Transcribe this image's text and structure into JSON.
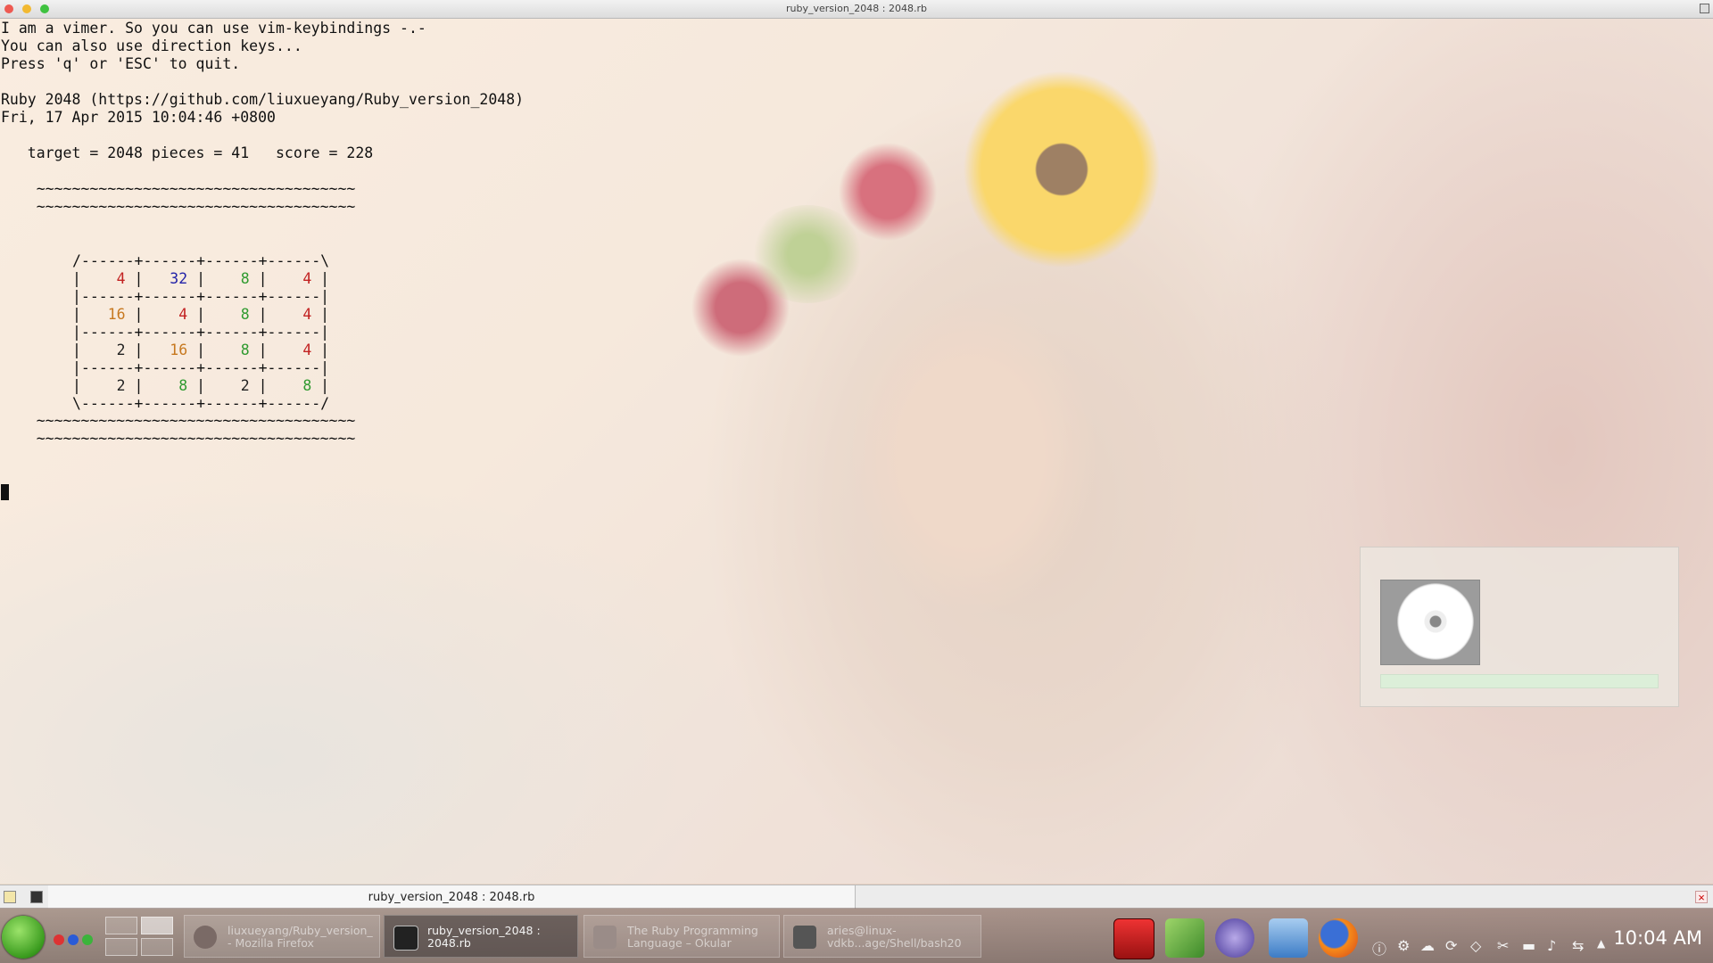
{
  "window": {
    "title": "ruby_version_2048 : 2048.rb"
  },
  "terminal": {
    "lines": [
      "I am a vimer. So you can use vim-keybindings -.-",
      "You can also use direction keys...",
      "Press 'q' or 'ESC' to quit.",
      "Ruby 2048 (https://github.com/liuxueyang/Ruby_version_2048)",
      "Fri, 17 Apr 2015 10:04:46 +0800",
      "   target = 2048 pieces = 41   score = 228",
      "    ~~~~~~~~~~~~~~~~~~~~~~~~~~~~~~~~~~~~",
      "    ~~~~~~~~~~~~~~~~~~~~~~~~~~~~~~~~~~~~",
      "    ~~~~~~~~~~~~~~~~~~~~~~~~~~~~~~~~~~~~",
      "    ~~~~~~~~~~~~~~~~~~~~~~~~~~~~~~~~~~~~"
    ],
    "board": {
      "top": "/------+------+------+------\\",
      "sep": "|------+------+------+------|",
      "bottom": "\\------+------+------+------/",
      "rows": [
        [
          4,
          32,
          8,
          4
        ],
        [
          16,
          4,
          8,
          4
        ],
        [
          2,
          16,
          8,
          4
        ],
        [
          2,
          8,
          2,
          8
        ]
      ]
    }
  },
  "tabbar": {
    "tab_title": "ruby_version_2048 : 2048.rb",
    "close_glyph": "×"
  },
  "taskbar": {
    "tasks": [
      {
        "label": "liuxueyang/Ruby_version_\n- Mozilla Firefox"
      },
      {
        "label": "ruby_version_2048 :\n2048.rb"
      },
      {
        "label": "The Ruby Programming\nLanguage – Okular"
      },
      {
        "label": "aries@linux-\nvdkb...age/Shell/bash20"
      }
    ],
    "clock": "10:04 AM"
  },
  "colors": {
    "tile_2": "#222222",
    "tile_4": "#c22222",
    "tile_8": "#2f9a2f",
    "tile_16": "#c7781f",
    "tile_32": "#2323a8"
  }
}
